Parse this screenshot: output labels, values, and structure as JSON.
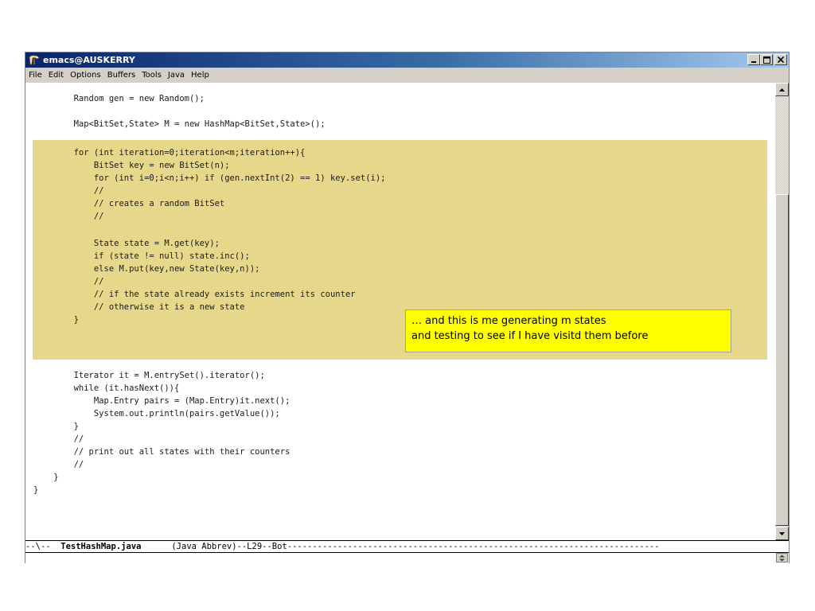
{
  "window": {
    "title": "emacs@AUSKERRY"
  },
  "menubar": {
    "items": [
      "File",
      "Edit",
      "Options",
      "Buffers",
      "Tools",
      "Java",
      "Help"
    ]
  },
  "code": {
    "lines": [
      "        Random gen = new Random();",
      "",
      "        Map<BitSet,State> M = new HashMap<BitSet,State>();",
      "",
      "        for (int iteration=0;iteration<m;iteration++){",
      "            BitSet key = new BitSet(n);",
      "            for (int i=0;i<n;i++) if (gen.nextInt(2) == 1) key.set(i);",
      "            //",
      "            // creates a random BitSet",
      "            //",
      "",
      "            State state = M.get(key);",
      "            if (state != null) state.inc();",
      "            else M.put(key,new State(key,n));",
      "            //",
      "            // if the state already exists increment its counter",
      "            // otherwise it is a new state",
      "        }",
      "",
      "",
      "        Iterator it = M.entrySet().iterator();",
      "        while (it.hasNext()){",
      "            Map.Entry pairs = (Map.Entry)it.next();",
      "            System.out.println(pairs.getValue());",
      "        }",
      "        //",
      "        // print out all states with their counters",
      "        //",
      "    }",
      "}"
    ]
  },
  "callout": {
    "line1": "… and this is me generating m states",
    "line2": "and testing to see if I have visitd them before"
  },
  "modeline": {
    "prefix": "--\\--  ",
    "filename": "TestHashMap.java",
    "mode": "      (Java Abbrev)--L29--Bot--------------------------------------------------------------------------"
  },
  "colors": {
    "highlight": "#e7d78a",
    "callout_bg": "#ffff00",
    "titlebar": "#0a246a"
  },
  "icons": [
    "emacs-gnu-icon",
    "minimize-icon",
    "maximize-icon",
    "close-icon",
    "scroll-up-icon",
    "scroll-down-icon"
  ]
}
